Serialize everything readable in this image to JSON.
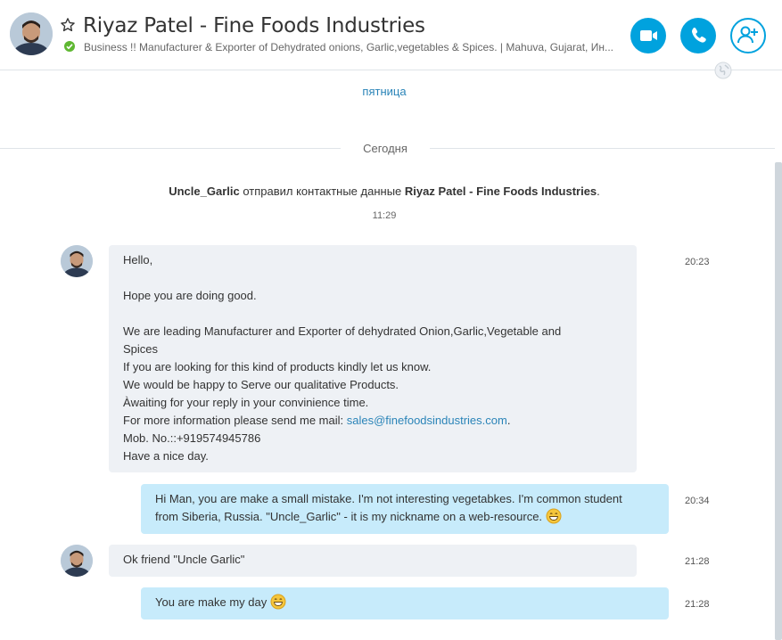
{
  "header": {
    "title": "Riyaz Patel - Fine Foods Industries",
    "mood": "Business !!  Manufacturer & Exporter of Dehydrated onions, Garlic,vegetables & Spices.  |  Mahuva, Gujarat, Ин...",
    "status_color": "#5fb832",
    "accent_color": "#00a2de",
    "icons": [
      "star-icon",
      "video-icon",
      "phone-icon",
      "add-contact-icon",
      "globe-icon"
    ]
  },
  "conversation": {
    "earlier_day_link": "пятница",
    "today_label": "Сегодня",
    "system_message": {
      "sender": "Uncle_Garlic",
      "action": " отправил контактные данные ",
      "contact": "Riyaz Patel - Fine Foods Industries",
      "end": ".",
      "time": "11:29"
    },
    "messages": [
      {
        "direction": "incoming",
        "time": "20:23",
        "lines": [
          "Hello,",
          "",
          "Hope you are doing good.",
          "",
          "We are leading Manufacturer and Exporter of dehydrated Onion,Garlic,Vegetable and",
          "Spices",
          "If you are looking for this kind of products kindly let us know.",
          "We would be happy to Serve our qualitative Products.",
          "Àwaiting for your reply in your convinience time."
        ],
        "mail_prefix": "For more information please send me mail: ",
        "mail_link": "sales@finefoodsindustries.com",
        "mail_suffix": ".",
        "lines_after": [
          "Mob. No.::+919574945786",
          "Have a nice day."
        ]
      },
      {
        "direction": "outgoing",
        "time": "20:34",
        "line1": "Hi Man, you are make a small mistake. I'm not interesting vegetabkes. I'm common student",
        "line2": "from Siberia, Russia. \"Uncle_Garlic\" - it is my nickname on a web-resource. ",
        "emoji": "grin-emoji-icon"
      },
      {
        "direction": "incoming",
        "time": "21:28",
        "text": "Ok friend \"Uncle Garlic\""
      },
      {
        "direction": "outgoing",
        "time": "21:28",
        "text": "You are make my day ",
        "emoji": "grin-emoji-icon"
      }
    ]
  },
  "colors": {
    "incoming_bubble": "#eef1f5",
    "outgoing_bubble": "#c7ebfb",
    "link": "#2a84b8"
  }
}
